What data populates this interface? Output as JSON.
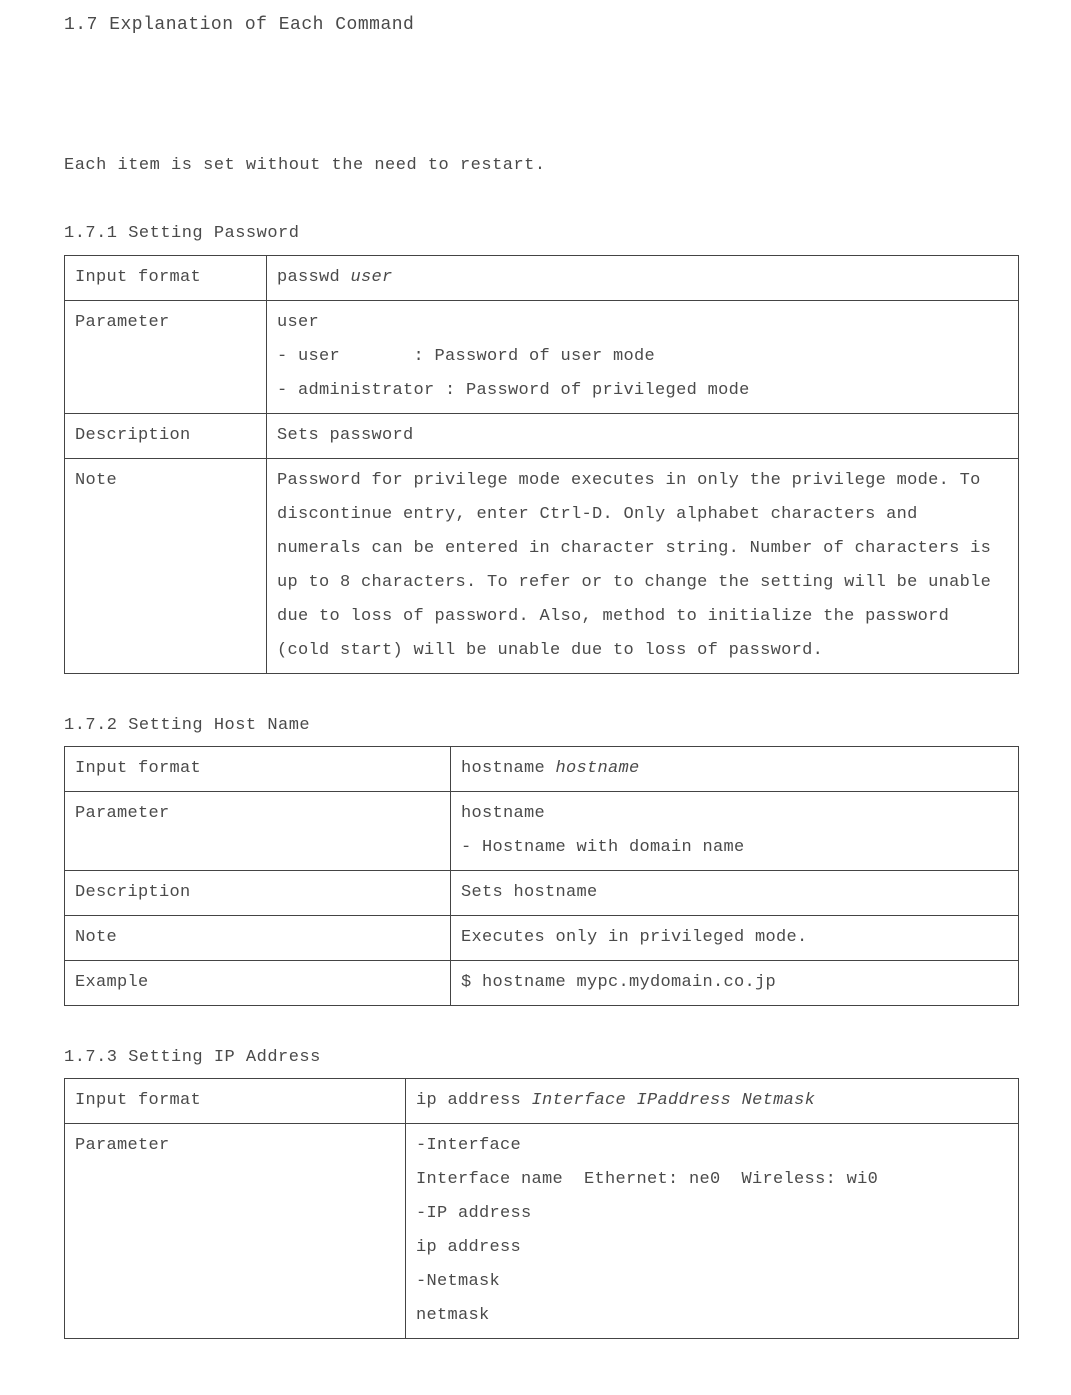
{
  "heading": "1.7 Explanation of Each Command",
  "intro": "Each item is set without the need to restart.",
  "sections": [
    {
      "title": "1.7.1  Setting Password",
      "tableClass": "t1",
      "rows": [
        {
          "label": "Input format",
          "html": "passwd <span class=\"italic\">user</span>"
        },
        {
          "label": "Parameter",
          "html": "user<br>- user &nbsp;&nbsp;&nbsp;&nbsp;&nbsp;&nbsp;: Password of user mode<br>- administrator : Password of privileged mode"
        },
        {
          "label": "Description",
          "html": "Sets password"
        },
        {
          "label": "Note",
          "html": "Password for privilege mode executes in only the privilege mode. To discontinue entry, enter Ctrl-D. Only alphabet characters and numerals can be entered in character string. Number of characters is up to 8 characters. To refer or to change the setting will be unable due to loss of password. Also, method to initialize the password (cold start) will be unable due to loss of password."
        }
      ]
    },
    {
      "title": "1.7.2 Setting Host Name",
      "tableClass": "t2",
      "rows": [
        {
          "label": "Input format",
          "html": "hostname <span class=\"italic\">hostname</span>"
        },
        {
          "label": "Parameter",
          "html": "hostname<br>- Hostname with domain name"
        },
        {
          "label": "Description",
          "html": "Sets hostname"
        },
        {
          "label": "Note",
          "html": "Executes only in privileged mode."
        },
        {
          "label": "Example",
          "html": "$ hostname mypc.mydomain.co.jp"
        }
      ]
    },
    {
      "title": "1.7.3 Setting IP Address",
      "tableClass": "t3",
      "rows": [
        {
          "label": "Input format",
          "html": "ip address <span class=\"italic\">Interface IPaddress Netmask</span>"
        },
        {
          "label": "Parameter",
          "html": "-Interface<br>Interface name &nbsp;Ethernet: ne0 &nbsp;Wireless: wi0<br>-IP address<br>ip address<br>-Netmask<br>netmask"
        }
      ]
    }
  ]
}
